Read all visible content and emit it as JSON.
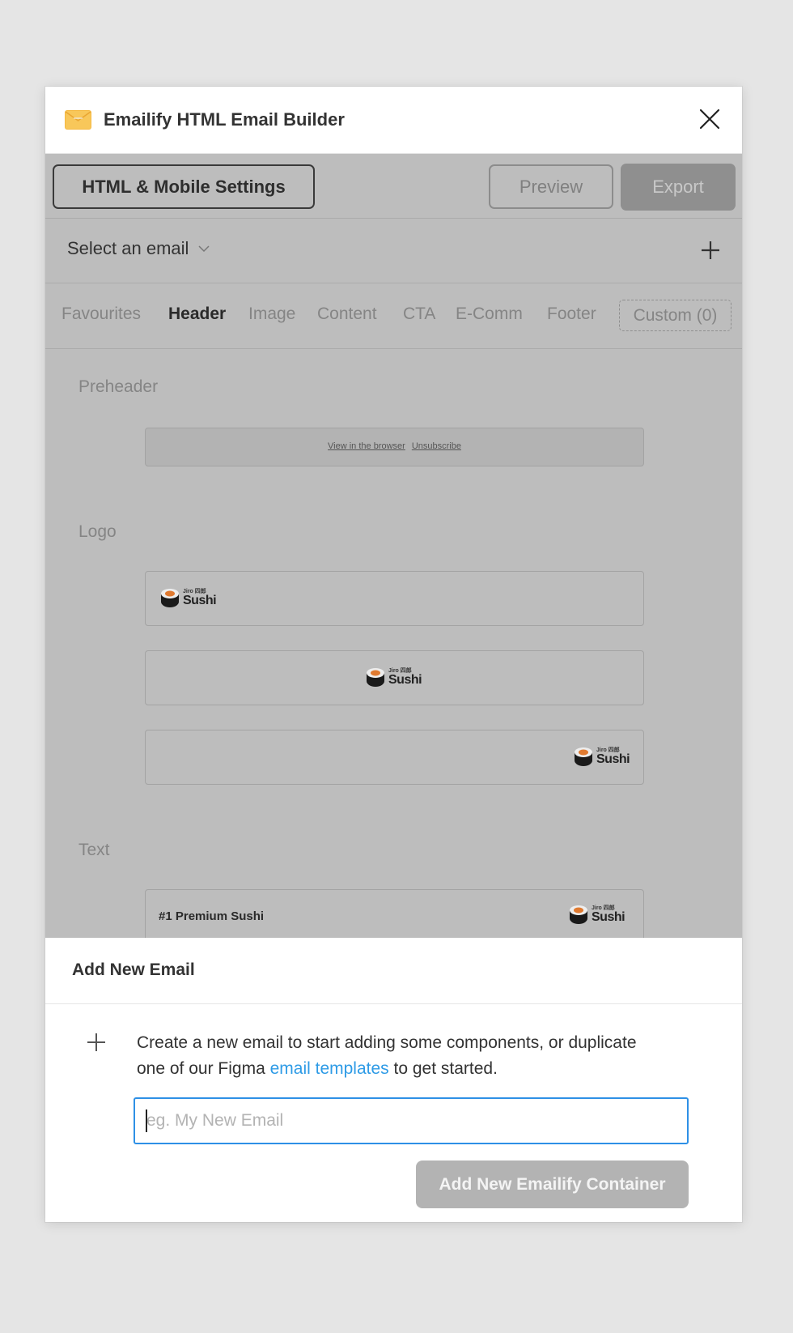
{
  "window": {
    "title": "Emailify HTML Email Builder",
    "logo_icon": "envelope-icon",
    "close_icon": "close-icon"
  },
  "toolbar": {
    "settings_label": "HTML & Mobile Settings",
    "preview_label": "Preview",
    "export_label": "Export"
  },
  "email_select": {
    "label": "Select an email",
    "chevron_icon": "chevron-down-icon",
    "add_icon": "plus-icon"
  },
  "tabs": [
    {
      "label": "Favourites",
      "active": false
    },
    {
      "label": "Header",
      "active": true
    },
    {
      "label": "Image",
      "active": false
    },
    {
      "label": "Content",
      "active": false
    },
    {
      "label": "CTA",
      "active": false
    },
    {
      "label": "E-Comm",
      "active": false
    },
    {
      "label": "Footer",
      "active": false
    },
    {
      "label": "Custom (0)",
      "active": false
    }
  ],
  "sections": {
    "preheader": {
      "label": "Preheader",
      "links": [
        "View in the browser",
        "Unsubscribe"
      ]
    },
    "logo": {
      "label": "Logo",
      "alignments": [
        "left",
        "center",
        "right"
      ],
      "brand_small": "Jiro 四郎",
      "brand_big": "Sushi"
    },
    "text": {
      "label": "Text",
      "card_title": "#1 Premium Sushi"
    }
  },
  "add_email": {
    "title": "Add New Email",
    "desc_before": "Create a new email to start adding some components, or duplicate one of our Figma ",
    "desc_link": "email templates",
    "desc_after": " to get started.",
    "input_placeholder": "eg. My New Email",
    "input_value": "",
    "submit_label": "Add New Emailify Container"
  },
  "colors": {
    "accent": "#2e90e6",
    "link": "#2e9be6",
    "dim_overlay": "#bdbdbd",
    "disabled_button": "#b3b3b3"
  }
}
